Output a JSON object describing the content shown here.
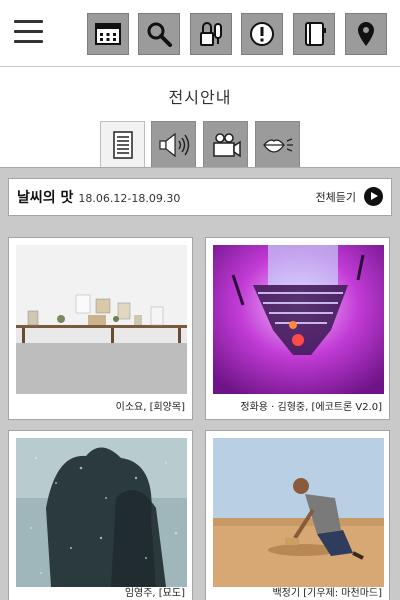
{
  "header": {
    "menu_icon": "hamburger-menu-icon",
    "buttons": [
      {
        "name": "calendar-icon"
      },
      {
        "name": "search-icon"
      },
      {
        "name": "audio-guide-icon"
      },
      {
        "name": "info-icon"
      },
      {
        "name": "notebook-icon"
      },
      {
        "name": "map-pin-icon"
      }
    ]
  },
  "page": {
    "title": "전시안내"
  },
  "media_tabs": [
    {
      "name": "text-tab",
      "icon": "document-icon",
      "active": true
    },
    {
      "name": "audio-tab",
      "icon": "speaker-icon",
      "active": false
    },
    {
      "name": "video-tab",
      "icon": "video-camera-icon",
      "active": false
    },
    {
      "name": "sign-language-tab",
      "icon": "lips-icon",
      "active": false
    }
  ],
  "exhibition": {
    "title": "날씨의 맛",
    "dates": "18.06.12-18.09.30",
    "listen_all_label": "전체듣기"
  },
  "artworks": [
    {
      "caption": "이소요, [회양목]"
    },
    {
      "caption": "정화용 · 김형중, [에코트론 V2.0]"
    },
    {
      "caption": "임영주, [묘도]"
    },
    {
      "caption": "백정기 [기우제: 마천마드]"
    }
  ],
  "colors": {
    "button_gray": "#9b9b9b",
    "panel_gray": "#c9c9c9",
    "accent_dark": "#111111"
  }
}
